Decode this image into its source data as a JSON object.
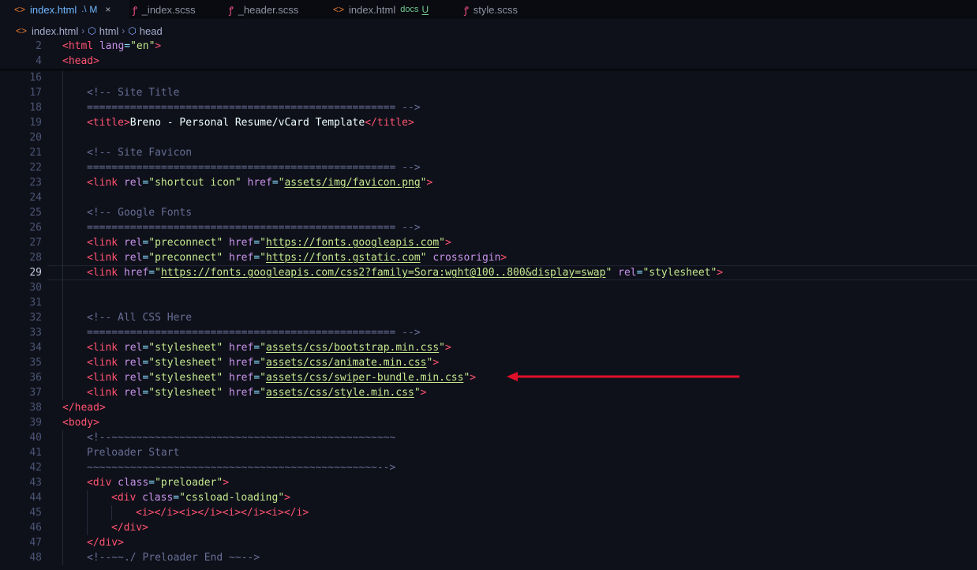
{
  "tabs": [
    {
      "icon": "<>",
      "icon_kind": "html",
      "name": "index.html",
      "dir": ".\\",
      "status": "M",
      "close": "×",
      "active": true
    },
    {
      "icon": "ꝭ",
      "icon_kind": "scss",
      "name": "_index.scss",
      "dir": "",
      "status": "",
      "close": "",
      "active": false
    },
    {
      "icon": "ꝭ",
      "icon_kind": "scss",
      "name": "_header.scss",
      "dir": "",
      "status": "",
      "close": "",
      "active": false
    },
    {
      "icon": "<>",
      "icon_kind": "html",
      "name": "index.html",
      "dir": "docs",
      "status": "U",
      "close": "",
      "active": false
    },
    {
      "icon": "ꝭ",
      "icon_kind": "scss",
      "name": "style.scss",
      "dir": "",
      "status": "",
      "close": "",
      "active": false
    }
  ],
  "breadcrumb": {
    "file_icon": "<>",
    "file": "index.html",
    "item1": "html",
    "item2": "head"
  },
  "editor": {
    "current_line": "29",
    "lines": [
      {
        "n": "2",
        "i": 0,
        "code": [
          [
            "t",
            "<"
          ],
          [
            "t",
            "html"
          ],
          [
            "x",
            " "
          ],
          [
            "a",
            "lang"
          ],
          [
            "p",
            "="
          ],
          [
            "s",
            "\"en\""
          ],
          [
            "t",
            ">"
          ]
        ]
      },
      {
        "n": "4",
        "i": 0,
        "code": [
          [
            "t",
            "<"
          ],
          [
            "t",
            "head"
          ],
          [
            "t",
            ">"
          ]
        ]
      },
      {
        "n": "16",
        "i": 1,
        "code": []
      },
      {
        "n": "17",
        "i": 1,
        "code": [
          [
            "c",
            "<!-- Site Title"
          ]
        ]
      },
      {
        "n": "18",
        "i": 1,
        "code": [
          [
            "c",
            "================================================== -->"
          ]
        ]
      },
      {
        "n": "19",
        "i": 1,
        "code": [
          [
            "t",
            "<"
          ],
          [
            "t",
            "title"
          ],
          [
            "t",
            ">"
          ],
          [
            "x",
            "Breno - Personal Resume/vCard Template"
          ],
          [
            "t",
            "</"
          ],
          [
            "t",
            "title"
          ],
          [
            "t",
            ">"
          ]
        ]
      },
      {
        "n": "20",
        "i": 1,
        "code": []
      },
      {
        "n": "21",
        "i": 1,
        "code": [
          [
            "c",
            "<!-- Site Favicon"
          ]
        ]
      },
      {
        "n": "22",
        "i": 1,
        "code": [
          [
            "c",
            "================================================== -->"
          ]
        ]
      },
      {
        "n": "23",
        "i": 1,
        "code": [
          [
            "t",
            "<"
          ],
          [
            "t",
            "link"
          ],
          [
            "x",
            " "
          ],
          [
            "a",
            "rel"
          ],
          [
            "p",
            "="
          ],
          [
            "s",
            "\"shortcut icon\""
          ],
          [
            "x",
            " "
          ],
          [
            "a",
            "href"
          ],
          [
            "p",
            "="
          ],
          [
            "s",
            "\""
          ],
          [
            "u",
            "assets/img/favicon.png"
          ],
          [
            "s",
            "\""
          ],
          [
            "t",
            ">"
          ]
        ]
      },
      {
        "n": "24",
        "i": 1,
        "code": []
      },
      {
        "n": "25",
        "i": 1,
        "code": [
          [
            "c",
            "<!-- Google Fonts"
          ]
        ]
      },
      {
        "n": "26",
        "i": 1,
        "code": [
          [
            "c",
            "================================================== -->"
          ]
        ]
      },
      {
        "n": "27",
        "i": 1,
        "code": [
          [
            "t",
            "<"
          ],
          [
            "t",
            "link"
          ],
          [
            "x",
            " "
          ],
          [
            "a",
            "rel"
          ],
          [
            "p",
            "="
          ],
          [
            "s",
            "\"preconnect\""
          ],
          [
            "x",
            " "
          ],
          [
            "a",
            "href"
          ],
          [
            "p",
            "="
          ],
          [
            "s",
            "\""
          ],
          [
            "u",
            "https://fonts.googleapis.com"
          ],
          [
            "s",
            "\""
          ],
          [
            "t",
            ">"
          ]
        ]
      },
      {
        "n": "28",
        "i": 1,
        "code": [
          [
            "t",
            "<"
          ],
          [
            "t",
            "link"
          ],
          [
            "x",
            " "
          ],
          [
            "a",
            "rel"
          ],
          [
            "p",
            "="
          ],
          [
            "s",
            "\"preconnect\""
          ],
          [
            "x",
            " "
          ],
          [
            "a",
            "href"
          ],
          [
            "p",
            "="
          ],
          [
            "s",
            "\""
          ],
          [
            "u",
            "https://fonts.gstatic.com"
          ],
          [
            "s",
            "\""
          ],
          [
            "x",
            " "
          ],
          [
            "a",
            "crossorigin"
          ],
          [
            "t",
            ">"
          ]
        ]
      },
      {
        "n": "29",
        "i": 1,
        "code": [
          [
            "t",
            "<"
          ],
          [
            "t",
            "link"
          ],
          [
            "x",
            " "
          ],
          [
            "a",
            "href"
          ],
          [
            "p",
            "="
          ],
          [
            "s",
            "\""
          ],
          [
            "u",
            "https://fonts.googleapis.com/css2?family=Sora:wght@100..800&display=swap"
          ],
          [
            "s",
            "\""
          ],
          [
            "x",
            " "
          ],
          [
            "a",
            "rel"
          ],
          [
            "p",
            "="
          ],
          [
            "s",
            "\"stylesheet\""
          ],
          [
            "t",
            ">"
          ]
        ]
      },
      {
        "n": "30",
        "i": 1,
        "code": []
      },
      {
        "n": "31",
        "i": 1,
        "code": []
      },
      {
        "n": "32",
        "i": 1,
        "code": [
          [
            "c",
            "<!-- All CSS Here"
          ]
        ]
      },
      {
        "n": "33",
        "i": 1,
        "code": [
          [
            "c",
            "================================================== -->"
          ]
        ]
      },
      {
        "n": "34",
        "i": 1,
        "code": [
          [
            "t",
            "<"
          ],
          [
            "t",
            "link"
          ],
          [
            "x",
            " "
          ],
          [
            "a",
            "rel"
          ],
          [
            "p",
            "="
          ],
          [
            "s",
            "\"stylesheet\""
          ],
          [
            "x",
            " "
          ],
          [
            "a",
            "href"
          ],
          [
            "p",
            "="
          ],
          [
            "s",
            "\""
          ],
          [
            "u",
            "assets/css/bootstrap.min.css"
          ],
          [
            "s",
            "\""
          ],
          [
            "t",
            ">"
          ]
        ]
      },
      {
        "n": "35",
        "i": 1,
        "code": [
          [
            "t",
            "<"
          ],
          [
            "t",
            "link"
          ],
          [
            "x",
            " "
          ],
          [
            "a",
            "rel"
          ],
          [
            "p",
            "="
          ],
          [
            "s",
            "\"stylesheet\""
          ],
          [
            "x",
            " "
          ],
          [
            "a",
            "href"
          ],
          [
            "p",
            "="
          ],
          [
            "s",
            "\""
          ],
          [
            "u",
            "assets/css/animate.min.css"
          ],
          [
            "s",
            "\""
          ],
          [
            "t",
            ">"
          ]
        ]
      },
      {
        "n": "36",
        "i": 1,
        "code": [
          [
            "t",
            "<"
          ],
          [
            "t",
            "link"
          ],
          [
            "x",
            " "
          ],
          [
            "a",
            "rel"
          ],
          [
            "p",
            "="
          ],
          [
            "s",
            "\"stylesheet\""
          ],
          [
            "x",
            " "
          ],
          [
            "a",
            "href"
          ],
          [
            "p",
            "="
          ],
          [
            "s",
            "\""
          ],
          [
            "u",
            "assets/css/swiper-bundle.min.css"
          ],
          [
            "s",
            "\""
          ],
          [
            "t",
            ">"
          ]
        ]
      },
      {
        "n": "37",
        "i": 1,
        "code": [
          [
            "t",
            "<"
          ],
          [
            "t",
            "link"
          ],
          [
            "x",
            " "
          ],
          [
            "a",
            "rel"
          ],
          [
            "p",
            "="
          ],
          [
            "s",
            "\"stylesheet\""
          ],
          [
            "x",
            " "
          ],
          [
            "a",
            "href"
          ],
          [
            "p",
            "="
          ],
          [
            "s",
            "\""
          ],
          [
            "u",
            "assets/css/style.min.css"
          ],
          [
            "s",
            "\""
          ],
          [
            "t",
            ">"
          ]
        ]
      },
      {
        "n": "38",
        "i": 0,
        "code": [
          [
            "t",
            "</"
          ],
          [
            "t",
            "head"
          ],
          [
            "t",
            ">"
          ]
        ]
      },
      {
        "n": "39",
        "i": 0,
        "code": [
          [
            "t",
            "<"
          ],
          [
            "t",
            "body"
          ],
          [
            "t",
            ">"
          ]
        ]
      },
      {
        "n": "40",
        "i": 1,
        "code": [
          [
            "c",
            "<!--~~~~~~~~~~~~~~~~~~~~~~~~~~~~~~~~~~~~~~~~~~~~~~"
          ]
        ]
      },
      {
        "n": "41",
        "i": 1,
        "code": [
          [
            "c",
            "Preloader Start"
          ]
        ]
      },
      {
        "n": "42",
        "i": 1,
        "code": [
          [
            "c",
            "~~~~~~~~~~~~~~~~~~~~~~~~~~~~~~~~~~~~~~~~~~~~~~~-->"
          ]
        ]
      },
      {
        "n": "43",
        "i": 1,
        "code": [
          [
            "t",
            "<"
          ],
          [
            "t",
            "div"
          ],
          [
            "x",
            " "
          ],
          [
            "a",
            "class"
          ],
          [
            "p",
            "="
          ],
          [
            "s",
            "\"preloader\""
          ],
          [
            "t",
            ">"
          ]
        ]
      },
      {
        "n": "44",
        "i": 2,
        "code": [
          [
            "t",
            "<"
          ],
          [
            "t",
            "div"
          ],
          [
            "x",
            " "
          ],
          [
            "a",
            "class"
          ],
          [
            "p",
            "="
          ],
          [
            "s",
            "\"cssload-loading\""
          ],
          [
            "t",
            ">"
          ]
        ]
      },
      {
        "n": "45",
        "i": 3,
        "code": [
          [
            "t",
            "<i></i><i></i><i></i><i></i>"
          ]
        ]
      },
      {
        "n": "46",
        "i": 2,
        "code": [
          [
            "t",
            "</"
          ],
          [
            "t",
            "div"
          ],
          [
            "t",
            ">"
          ]
        ]
      },
      {
        "n": "47",
        "i": 1,
        "code": [
          [
            "t",
            "</"
          ],
          [
            "t",
            "div"
          ],
          [
            "t",
            ">"
          ]
        ]
      },
      {
        "n": "48",
        "i": 1,
        "code": [
          [
            "c",
            "<!--~~./ Preloader End ~~-->"
          ]
        ]
      }
    ]
  },
  "annotation": {
    "color": "#e0102a"
  }
}
